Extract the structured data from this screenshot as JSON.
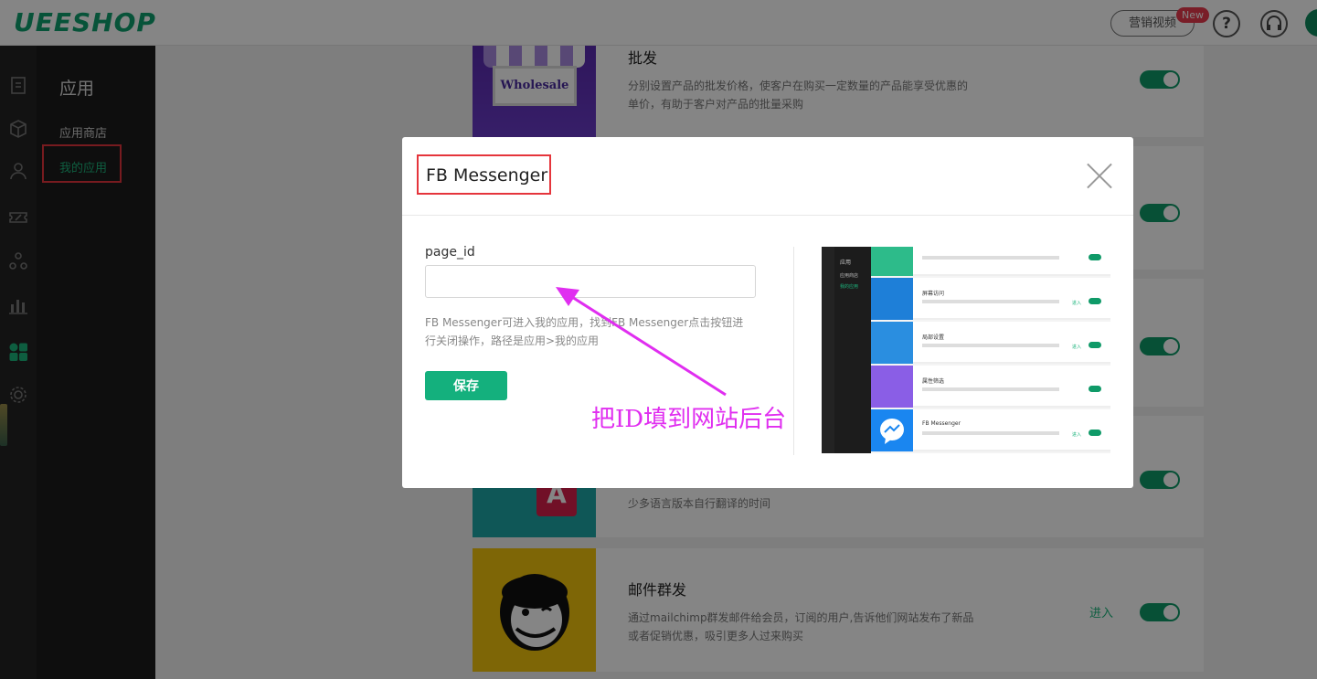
{
  "header": {
    "logo": "UEESHOP",
    "marketing_video": "营销视频",
    "new_badge": "New",
    "help_icon": "?"
  },
  "sidebar": {
    "title": "应用",
    "items": [
      {
        "label": "应用商店"
      },
      {
        "label": "我的应用"
      }
    ]
  },
  "cards": [
    {
      "title": "批发",
      "desc": "分别设置产品的批发价格，使客户在购买一定数量的产品能享受优惠的单价，有助于客户对产品的批量采购",
      "thumb_text": "Wholesale"
    },
    {
      "desc": "少多语言版本自行翻译的时间",
      "thumb_text": "A"
    },
    {
      "title": "邮件群发",
      "desc": "通过mailchimp群发邮件给会员，订阅的用户,告诉他们网站发布了新品或者促销优惠，吸引更多人过来购买",
      "enter": "进入"
    }
  ],
  "modal": {
    "title": "FB Messenger",
    "field_label": "page_id",
    "field_value": "",
    "help_text": "FB Messenger可进入我的应用，找到FB Messenger点击按钮进行关闭操作，路径是应用>我的应用",
    "save_label": "保存",
    "annotation": "把ID填到网站后台"
  },
  "preview": {
    "menu_title": "应用",
    "menu_items": [
      "应用商店",
      "我的应用"
    ],
    "rows": [
      {
        "title": "",
        "enter": ""
      },
      {
        "title": "屏幕访问",
        "enter": "进入"
      },
      {
        "title": "局部设置",
        "enter": "进入"
      },
      {
        "title": "属性筛选",
        "enter": ""
      },
      {
        "title": "FB Messenger",
        "enter": "进入"
      }
    ]
  },
  "colors": {
    "brand_green": "#0fa06e",
    "toggle_green": "#0f9a68",
    "highlight_red": "#e5353c",
    "annotation_magenta": "#e02ef0"
  }
}
